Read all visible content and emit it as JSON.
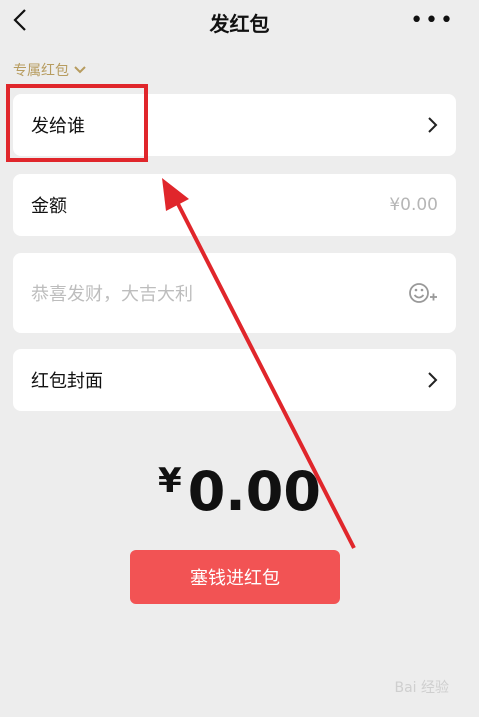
{
  "nav": {
    "title": "发红包",
    "more_label": "•••"
  },
  "tag": {
    "label": "专属红包"
  },
  "rows": {
    "recipient": "发给谁",
    "amount_label": "金额",
    "amount_value": "¥0.00",
    "message_placeholder": "恭喜发财，大吉大利",
    "cover": "红包封面"
  },
  "total": {
    "yen": "¥",
    "value": "0.00"
  },
  "submit": {
    "label": "塞钱进红包"
  },
  "watermark": "Bai 经验",
  "colors": {
    "accent": "#f25354",
    "tag": "#b79c5f",
    "annotation": "#e0262b"
  }
}
